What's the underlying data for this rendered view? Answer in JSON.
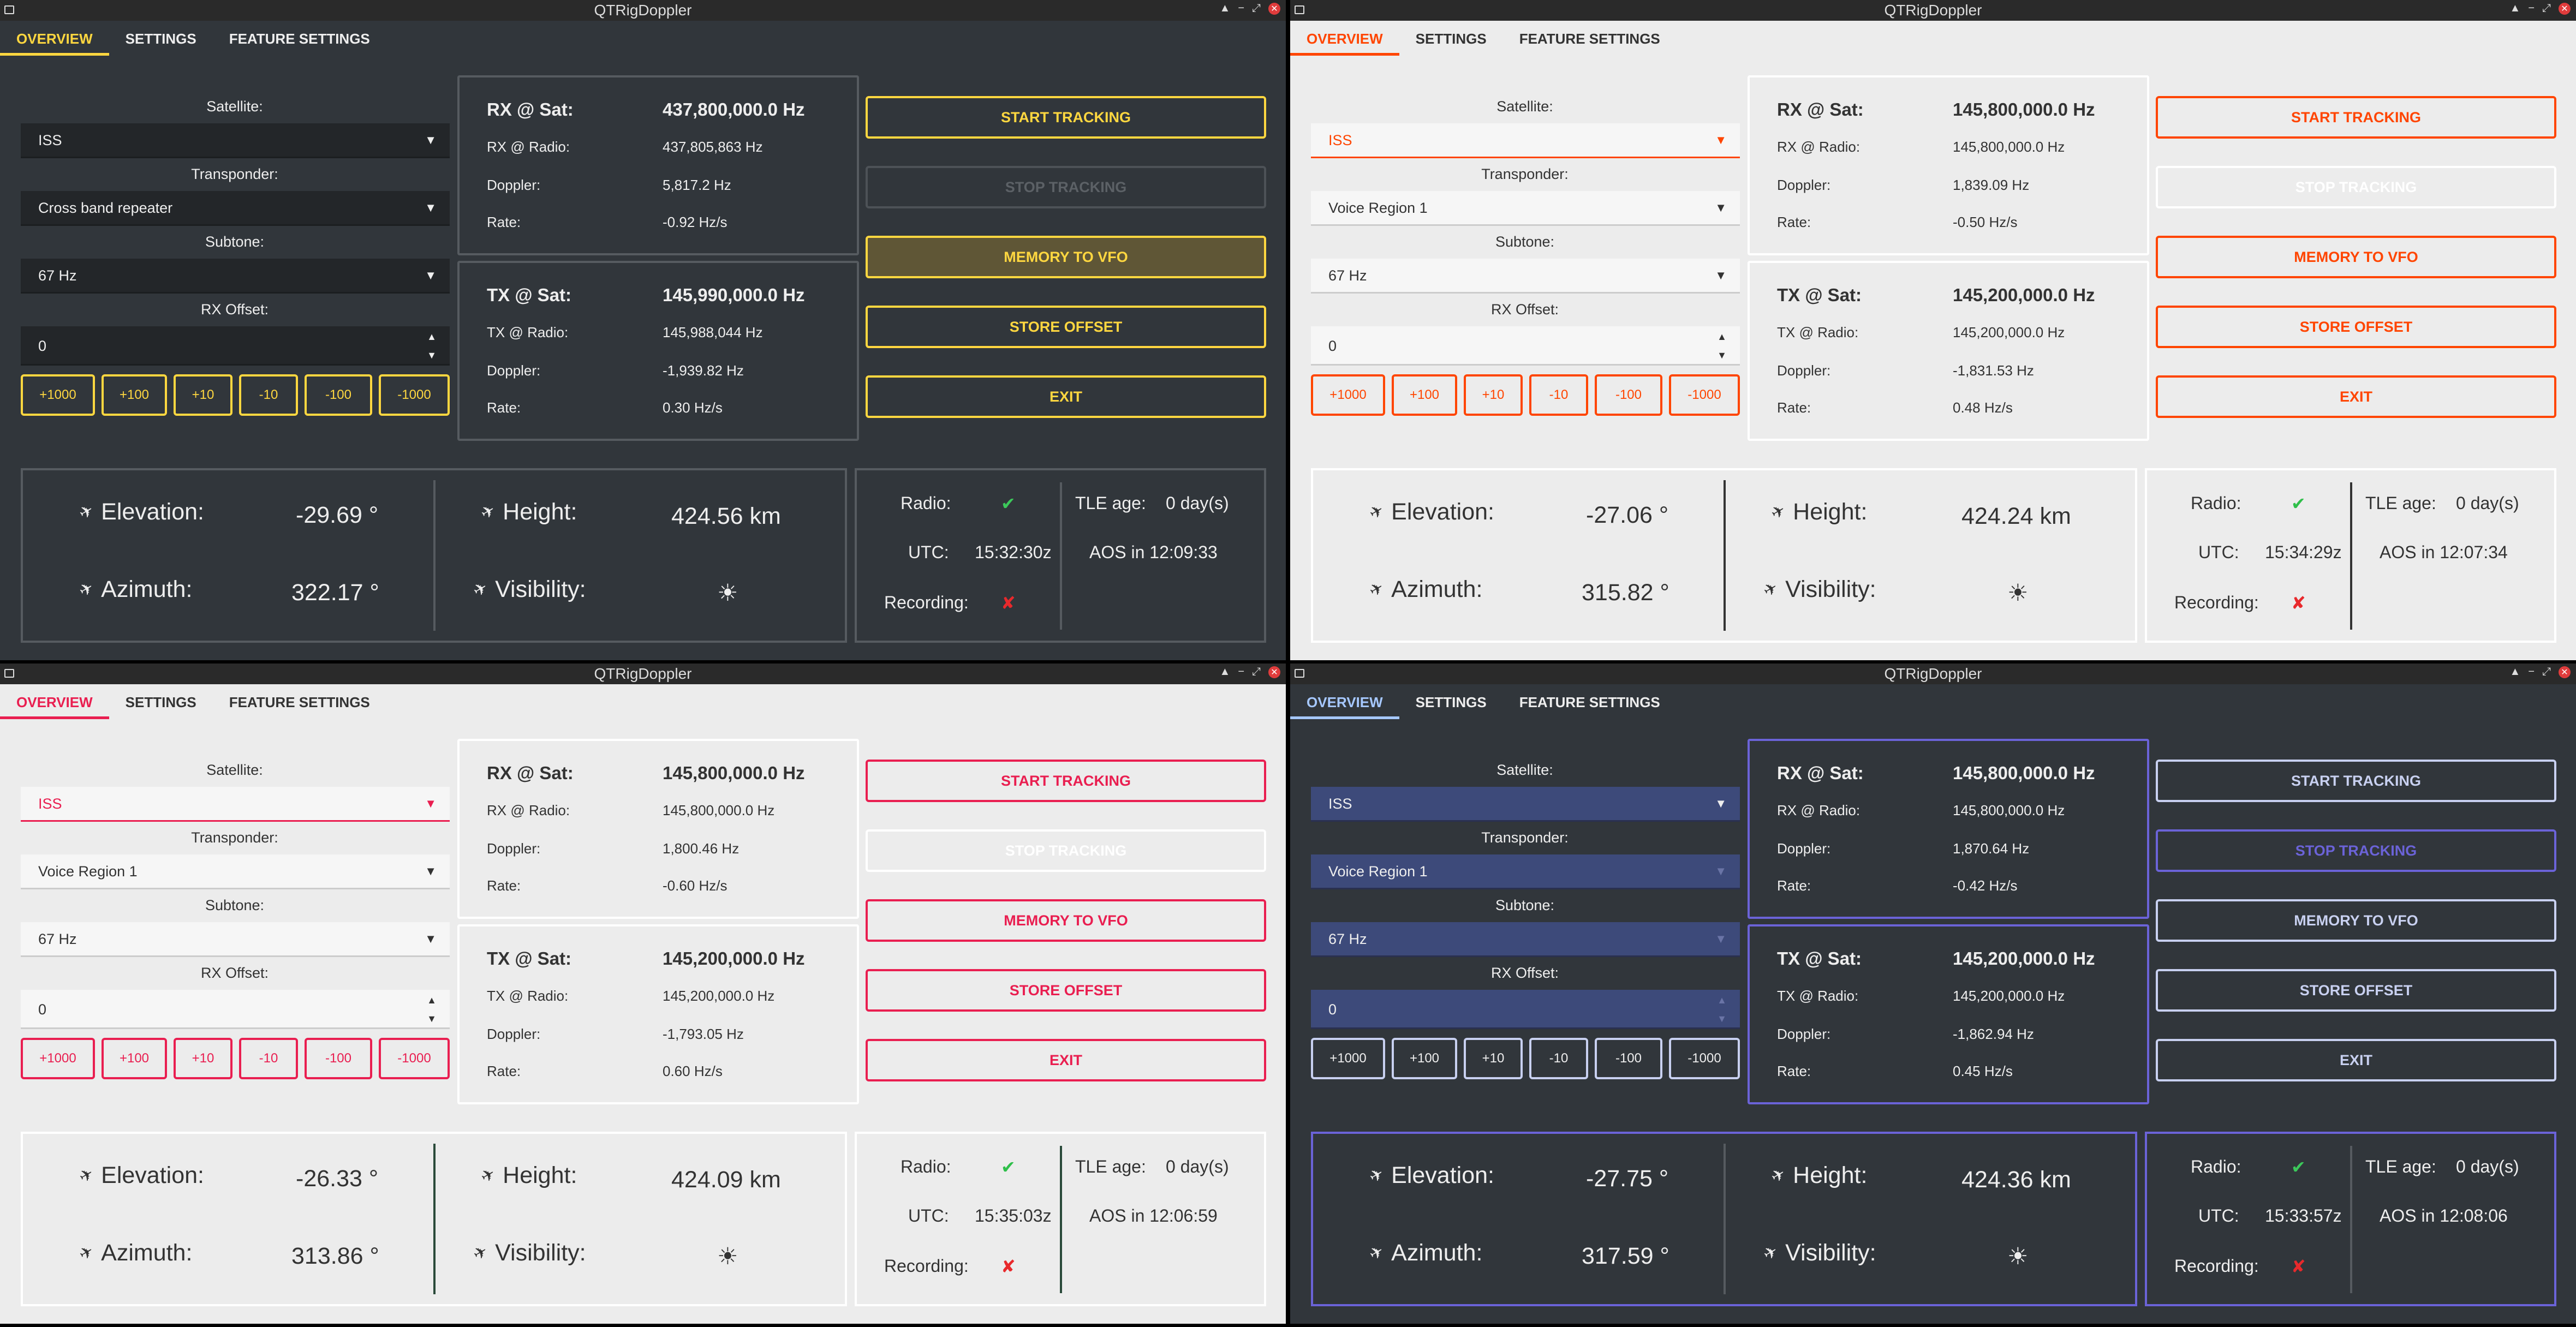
{
  "app_title": "QTRigDoppler",
  "tabs": [
    "OVERVIEW",
    "SETTINGS",
    "FEATURE SETTINGS"
  ],
  "labels": {
    "satellite": "Satellite:",
    "transponder": "Transponder:",
    "subtone": "Subtone:",
    "rx_offset": "RX Offset:",
    "rx_sat": "RX @ Sat:",
    "rx_radio": "RX @ Radio:",
    "tx_sat": "TX @ Sat:",
    "tx_radio": "TX @ Radio:",
    "doppler": "Doppler:",
    "rate": "Rate:",
    "elevation": "Elevation:",
    "azimuth": "Azimuth:",
    "height": "Height:",
    "visibility": "Visibility:",
    "radio": "Radio:",
    "utc": "UTC:",
    "recording": "Recording:",
    "tle_age": "TLE age:"
  },
  "step_buttons": [
    "+1000",
    "+100",
    "+10",
    "-10",
    "-100",
    "-1000"
  ],
  "action_buttons": {
    "start": "START TRACKING",
    "stop": "STOP TRACKING",
    "memory": "MEMORY TO VFO",
    "store": "STORE OFFSET",
    "exit": "EXIT"
  },
  "icons": {
    "satellite": "satellite-icon",
    "visibility": "sun-icon",
    "radio_ok": "check-icon",
    "recording_off": "cross-icon"
  },
  "windows": [
    {
      "theme": "dark-yellow",
      "accent": "#ffd740",
      "satellite": "ISS",
      "transponder": "Cross band repeater",
      "subtone": "67 Hz",
      "rx_offset": "0",
      "rx": {
        "sat": "437,800,000.0 Hz",
        "radio": "437,805,863 Hz",
        "doppler": "5,817.2 Hz",
        "rate": "-0.92 Hz/s"
      },
      "tx": {
        "sat": "145,990,000.0 Hz",
        "radio": "145,988,044 Hz",
        "doppler": "-1,939.82 Hz",
        "rate": "0.30 Hz/s"
      },
      "elevation": "-29.69 °",
      "azimuth": "322.17 °",
      "height": "424.56 km",
      "visibility": "☀",
      "radio": "✔",
      "utc": "15:32:30z",
      "recording": "✘",
      "tle_age": "0 day(s)",
      "aos": "AOS in 12:09:33"
    },
    {
      "theme": "light-orange",
      "accent": "#ff4500",
      "satellite": "ISS",
      "transponder": "Voice Region 1",
      "subtone": "67 Hz",
      "rx_offset": "0",
      "rx": {
        "sat": "145,800,000.0 Hz",
        "radio": "145,800,000.0 Hz",
        "doppler": "1,839.09 Hz",
        "rate": "-0.50 Hz/s"
      },
      "tx": {
        "sat": "145,200,000.0 Hz",
        "radio": "145,200,000.0 Hz",
        "doppler": "-1,831.53 Hz",
        "rate": "0.48 Hz/s"
      },
      "elevation": "-27.06 °",
      "azimuth": "315.82 °",
      "height": "424.24 km",
      "visibility": "☀",
      "radio": "✔",
      "utc": "15:34:29z",
      "recording": "✘",
      "tle_age": "0 day(s)",
      "aos": "AOS in 12:07:34"
    },
    {
      "theme": "light-pink",
      "accent": "#e91e50",
      "satellite": "ISS",
      "transponder": "Voice Region 1",
      "subtone": "67 Hz",
      "rx_offset": "0",
      "rx": {
        "sat": "145,800,000.0 Hz",
        "radio": "145,800,000.0 Hz",
        "doppler": "1,800.46 Hz",
        "rate": "-0.60 Hz/s"
      },
      "tx": {
        "sat": "145,200,000.0 Hz",
        "radio": "145,200,000.0 Hz",
        "doppler": "-1,793.05 Hz",
        "rate": "0.60 Hz/s"
      },
      "elevation": "-26.33 °",
      "azimuth": "313.86 °",
      "height": "424.09 km",
      "visibility": "☀",
      "radio": "✔",
      "utc": "15:35:03z",
      "recording": "✘",
      "tle_age": "0 day(s)",
      "aos": "AOS in 12:06:59"
    },
    {
      "theme": "dark-blue",
      "accent": "#a6c8ff",
      "satellite": "ISS",
      "transponder": "Voice Region 1",
      "subtone": "67 Hz",
      "rx_offset": "0",
      "rx": {
        "sat": "145,800,000.0 Hz",
        "radio": "145,800,000.0 Hz",
        "doppler": "1,870.64 Hz",
        "rate": "-0.42 Hz/s"
      },
      "tx": {
        "sat": "145,200,000.0 Hz",
        "radio": "145,200,000.0 Hz",
        "doppler": "-1,862.94 Hz",
        "rate": "0.45 Hz/s"
      },
      "elevation": "-27.75 °",
      "azimuth": "317.59 °",
      "height": "424.36 km",
      "visibility": "☀",
      "radio": "✔",
      "utc": "15:33:57z",
      "recording": "✘",
      "tle_age": "0 day(s)",
      "aos": "AOS in 12:08:06"
    }
  ]
}
